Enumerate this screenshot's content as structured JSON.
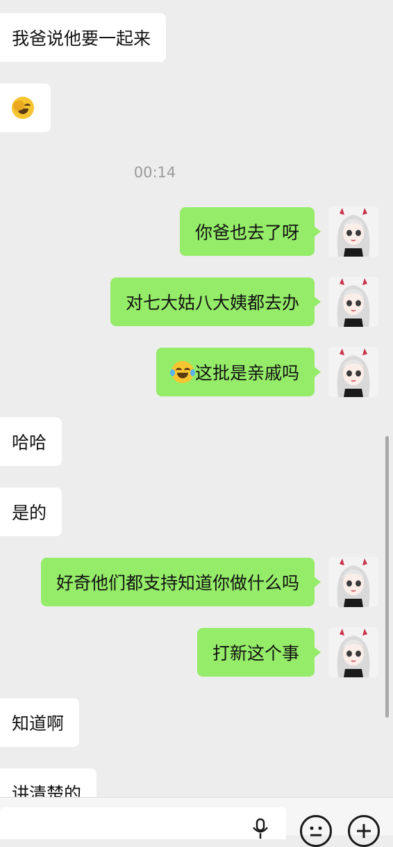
{
  "messages": [
    {
      "side": "in",
      "text": "我爸说他要一起来"
    },
    {
      "side": "in",
      "emoji": "face-palm-emoji"
    },
    {
      "timestamp": "00:14"
    },
    {
      "side": "out",
      "text": "你爸也去了呀"
    },
    {
      "side": "out",
      "text": "对七大姑八大姨都去办"
    },
    {
      "side": "out",
      "emoji": "tears-of-joy-emoji",
      "text": "这批是亲戚吗"
    },
    {
      "side": "in",
      "text": "哈哈"
    },
    {
      "side": "in",
      "text": "是的"
    },
    {
      "side": "out",
      "text": "好奇他们都支持知道你做什么吗"
    },
    {
      "side": "out",
      "text": "打新这个事"
    },
    {
      "side": "in",
      "text": "知道啊"
    },
    {
      "side": "in",
      "text": "讲清楚的"
    }
  ],
  "theme": {
    "outgoing_bubble": "#95ec69",
    "incoming_bubble": "#ffffff",
    "background": "#ededed"
  },
  "input_bar": {
    "icons": [
      "microphone-icon",
      "emoji-face-icon",
      "plus-icon"
    ]
  }
}
